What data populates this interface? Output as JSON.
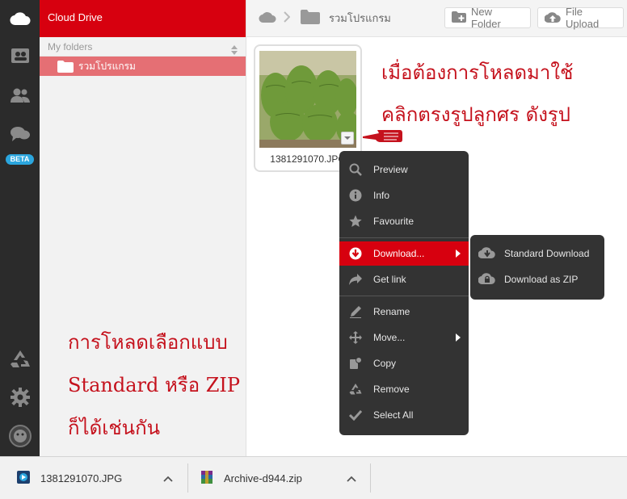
{
  "sidebar_title": "Cloud Drive",
  "rail": {
    "beta_label": "BETA"
  },
  "folders": {
    "header": "My folders",
    "items": [
      {
        "label": "รวมโปรแกรม"
      }
    ]
  },
  "breadcrumb": {
    "folder": "รวมโปรแกรม"
  },
  "toolbar": {
    "new_folder": "New Folder",
    "file_upload": "File Upload"
  },
  "file": {
    "name": "1381291070.JPG"
  },
  "annotations": {
    "right_line1": "เมื่อต้องการโหลดมาใช้",
    "right_line2": "คลิกตรงรูปลูกศร  ดังรูป",
    "left_line1": "การโหลดเลือกแบบ",
    "left_line2": "Standard  หรือ  ZIP",
    "left_line3": "ก็ได้เช่นกัน"
  },
  "context_menu": {
    "items": [
      {
        "label": "Preview",
        "icon": "search-icon"
      },
      {
        "label": "Info",
        "icon": "info-icon"
      },
      {
        "label": "Favourite",
        "icon": "star-icon"
      },
      {
        "label": "Download...",
        "icon": "download-icon",
        "active": true
      },
      {
        "label": "Get link",
        "icon": "share-arrow-icon"
      },
      {
        "label": "Rename",
        "icon": "pencil-icon"
      },
      {
        "label": "Move...",
        "icon": "move-icon"
      },
      {
        "label": "Copy",
        "icon": "copy-icon"
      },
      {
        "label": "Remove",
        "icon": "recycle-icon"
      },
      {
        "label": "Select All",
        "icon": "check-icon"
      }
    ]
  },
  "download_submenu": {
    "items": [
      {
        "label": "Standard Download",
        "icon": "cloud-download-icon"
      },
      {
        "label": "Download as ZIP",
        "icon": "zip-lock-icon"
      }
    ]
  },
  "download_bar": {
    "items": [
      {
        "name": "1381291070.JPG"
      },
      {
        "name": "Archive-d944.zip"
      }
    ]
  },
  "colors": {
    "brand": "#d7000f",
    "menu_bg": "#333333",
    "note": "#c5121d",
    "folder_selected": "#e56f74"
  }
}
